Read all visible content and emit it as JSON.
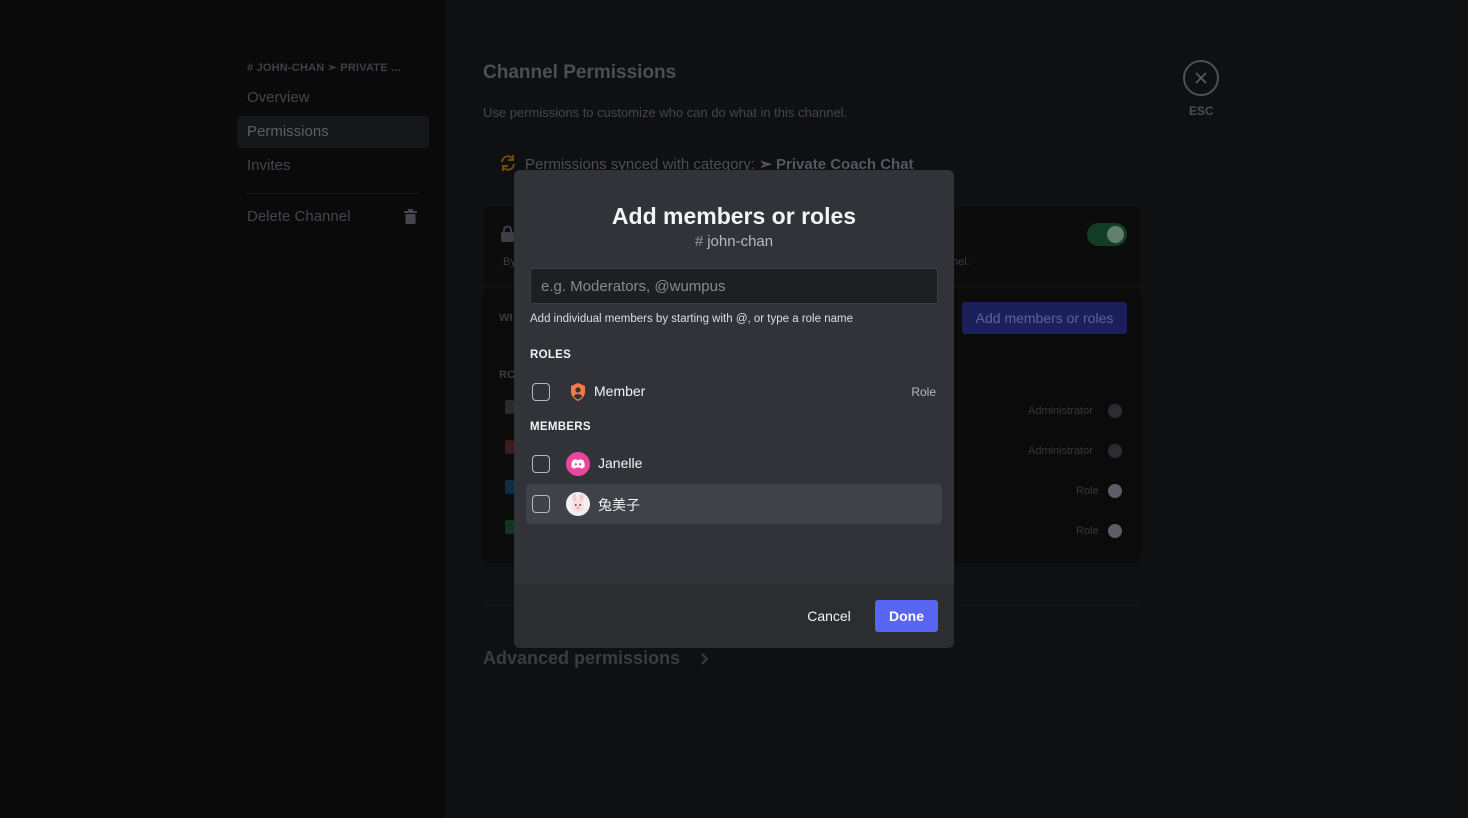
{
  "sidebar": {
    "breadcrumb": "# JOHN-CHAN ➣ PRIVATE ...",
    "items": [
      {
        "label": "Overview"
      },
      {
        "label": "Permissions"
      },
      {
        "label": "Invites"
      },
      {
        "label": "Delete Channel"
      }
    ]
  },
  "main": {
    "title": "Channel Permissions",
    "subtitle": "Use permissions to customize who can do what in this channel.",
    "sync_text": "Permissions synced with category: ",
    "sync_category": "➣ Private Coach Chat",
    "panel_a_left": "By",
    "panel_a_right": "nel.",
    "panel_b_left_1": "WI",
    "panel_b_left_2": "RC",
    "add_button": "Add members or roles",
    "rows": [
      {
        "label": "Administrator"
      },
      {
        "label": "Administrator"
      },
      {
        "label": "Role"
      },
      {
        "label": "Role"
      }
    ],
    "advanced": "Advanced permissions"
  },
  "esc_label": "ESC",
  "modal": {
    "title": "Add members or roles",
    "channel": "john-chan",
    "search_placeholder": "e.g. Moderators, @wumpus",
    "hint": "Add individual members by starting with @, or type a role name",
    "roles_header": "ROLES",
    "roles": [
      {
        "name": "Member",
        "type": "Role",
        "color": "#f47b42"
      }
    ],
    "members_header": "MEMBERS",
    "members": [
      {
        "name": "Janelle",
        "avatar": "discord-icon",
        "color": "#eb459f"
      },
      {
        "name": "兔美子",
        "avatar": "bunny-avatar"
      }
    ],
    "cancel": "Cancel",
    "done": "Done"
  }
}
